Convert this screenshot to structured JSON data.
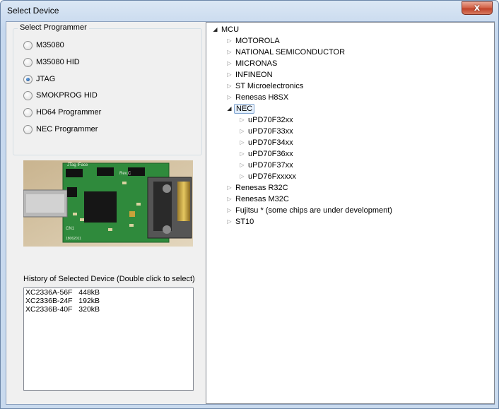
{
  "window": {
    "title": "Select Device",
    "close_glyph": "x"
  },
  "programmer_group": {
    "label": "Select Programmer",
    "options": [
      {
        "label": "M35080",
        "checked": false
      },
      {
        "label": "M35080 HID",
        "checked": false
      },
      {
        "label": "JTAG",
        "checked": true
      },
      {
        "label": "SMOKPROG HID",
        "checked": false
      },
      {
        "label": "HD64 Programmer",
        "checked": false
      },
      {
        "label": "NEC Programmer",
        "checked": false
      }
    ]
  },
  "photo": {
    "board_label_1": "JTag IFace",
    "board_label_2": "Rev.C",
    "board_label_3": "CN1",
    "board_label_4": "18062011"
  },
  "history": {
    "label": "History of Selected Device (Double click to select)",
    "items": [
      "XC2336A-56F   448kB",
      "XC2336B-24F   192kB",
      "XC2336B-40F   320kB"
    ]
  },
  "tree": {
    "root": "MCU",
    "manufacturers": [
      "MOTOROLA",
      "NATIONAL SEMICONDUCTOR",
      "MICRONAS",
      "INFINEON",
      "ST Microelectronics",
      "Renesas H8SX",
      "NEC",
      "Renesas R32C",
      "Renesas M32C",
      "Fujitsu * (some chips are under development)",
      "ST10"
    ],
    "nec_children": [
      "uPD70F32xx",
      "uPD70F33xx",
      "uPD70F34xx",
      "uPD70F36xx",
      "uPD70F37xx",
      "uPD76Fxxxxx"
    ]
  },
  "colors": {
    "title_bar": "#c9daee",
    "selection": "#dcebfc",
    "close_button": "#c1432a"
  }
}
